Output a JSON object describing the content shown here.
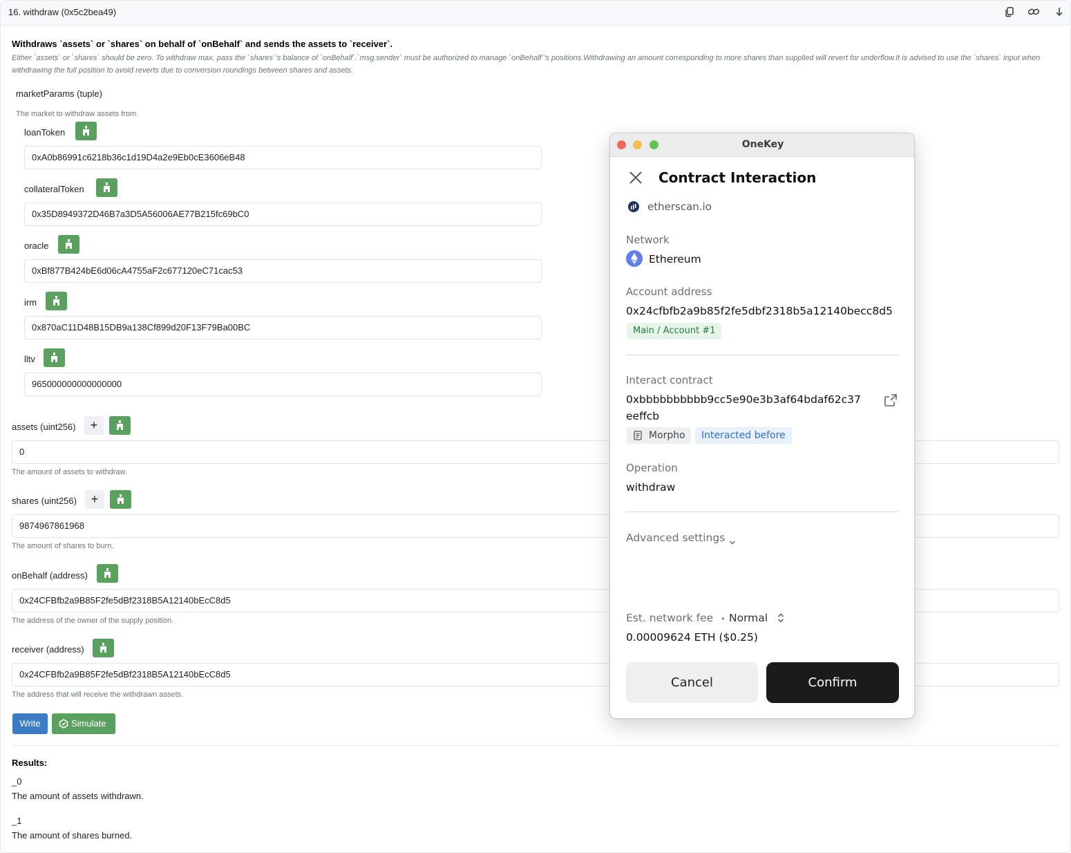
{
  "header": {
    "title": "16. withdraw (0x5c2bea49)",
    "icons": [
      "copy-icon",
      "link-icon",
      "arrow-down-icon"
    ]
  },
  "description": {
    "title": "Withdraws `assets` or `shares` on behalf of `onBehalf` and sends the assets to `receiver`.",
    "body": "Either `assets` or `shares` should be zero. To withdraw max, pass the `shares`'s balance of `onBehalf`.`msg.sender` must be authorized to manage `onBehalf`'s positions.Withdrawing an amount corresponding to more shares than supplied will revert for underflow.It is advised to use the `shares` input when withdrawing the full position to avoid reverts due to conversion roundings between shares and assets."
  },
  "marketParams": {
    "label": "marketParams (tuple)",
    "help": "The market to withdraw assets from.",
    "fields": [
      {
        "label": "loanToken",
        "value": "0xA0b86991c6218b36c1d19D4a2e9Eb0cE3606eB48"
      },
      {
        "label": "collateralToken",
        "value": "0x35D8949372D46B7a3D5A56006AE77B215fc69bC0"
      },
      {
        "label": "oracle",
        "value": "0xBf877B424bE6d06cA4755aF2c677120eC71cac53"
      },
      {
        "label": "irm",
        "value": "0x870aC11D48B15DB9a138Cf899d20F13F79Ba00BC"
      },
      {
        "label": "lltv",
        "value": "965000000000000000"
      }
    ]
  },
  "params": {
    "assets": {
      "label": "assets (uint256)",
      "value": "0",
      "help": "The amount of assets to withdraw.",
      "plus": "+"
    },
    "shares": {
      "label": "shares (uint256)",
      "value": "9874967861968",
      "help": "The amount of shares to burn.",
      "plus": "+"
    },
    "onBehalf": {
      "label": "onBehalf (address)",
      "value": "0x24CFBfb2a9B85F2fe5dBf2318B5A12140bEcC8d5",
      "help": "The address of the owner of the supply position."
    },
    "receiver": {
      "label": "receiver (address)",
      "value": "0x24CFBfb2a9B85F2fe5dBf2318B5A12140bEcC8d5",
      "help": "The address that will receive the withdrawn assets."
    }
  },
  "actions": {
    "write": "Write",
    "simulate": "Simulate"
  },
  "results": {
    "title": "Results:",
    "items": [
      {
        "name": "_0",
        "desc": "The amount of assets withdrawn."
      },
      {
        "name": "_1",
        "desc": "The amount of shares burned."
      }
    ]
  },
  "popup": {
    "window_title": "OneKey",
    "heading": "Contract Interaction",
    "site": "etherscan.io",
    "network_label": "Network",
    "network_value": "Ethereum",
    "account_label": "Account address",
    "account_value": "0x24cfbfb2a9b85f2fe5dbf2318b5a12140becc8d5",
    "account_badge": "Main / Account #1",
    "contract_label": "Interact contract",
    "contract_line1": "0xbbbbbbbbbb9cc5e90e3b3af64bdaf62c37",
    "contract_line2": "eeffcb",
    "contract_tag": "Morpho",
    "contract_status": "Interacted before",
    "operation_label": "Operation",
    "operation_value": "withdraw",
    "advanced": "Advanced settings",
    "fee_label": "Est. network fee",
    "fee_sep": "•",
    "fee_speed": "Normal",
    "fee_value": "0.00009624 ETH ($0.25)",
    "cancel": "Cancel",
    "confirm": "Confirm",
    "colors": {
      "red": "#ed6a5e",
      "yellow": "#f5bf4f",
      "green": "#61c554"
    }
  }
}
